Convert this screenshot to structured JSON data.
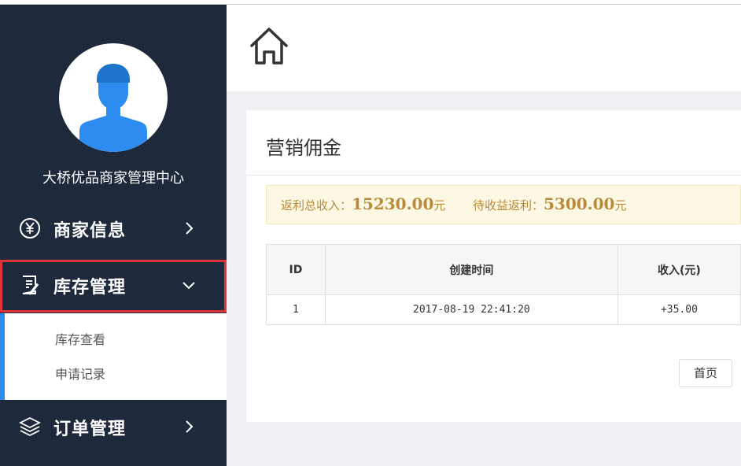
{
  "sidebar": {
    "shop_name": "大桥优品商家管理中心",
    "menu": {
      "merchant_info": "商家信息",
      "stock_management": "库存管理",
      "order_management": "订单管理"
    },
    "stock_submenu": {
      "view": "库存查看",
      "records": "申请记录"
    }
  },
  "page": {
    "title": "营销佣金",
    "summary": {
      "total_label": "返利总收入：",
      "total_value": "15230.00",
      "total_unit": "元",
      "pending_label": "待收益返利：",
      "pending_value": "5300.00",
      "pending_unit": "元"
    },
    "table": {
      "headers": [
        "ID",
        "创建时间",
        "收入(元)"
      ],
      "rows": [
        [
          "1",
          "2017-08-19 22:41:20",
          "+35.00"
        ]
      ]
    },
    "pagination": {
      "first_label": "首页"
    }
  },
  "colors": {
    "sidebar_bg": "#1e2a3b",
    "accent_blue": "#2d8cf0",
    "highlight_red": "#e0323a",
    "summary_text": "#b88a3a"
  },
  "icons": {
    "avatar": "user-silhouette-icon",
    "merchant": "yen-circle-icon",
    "stock": "document-edit-icon",
    "order": "layers-icon",
    "home": "home-icon"
  }
}
